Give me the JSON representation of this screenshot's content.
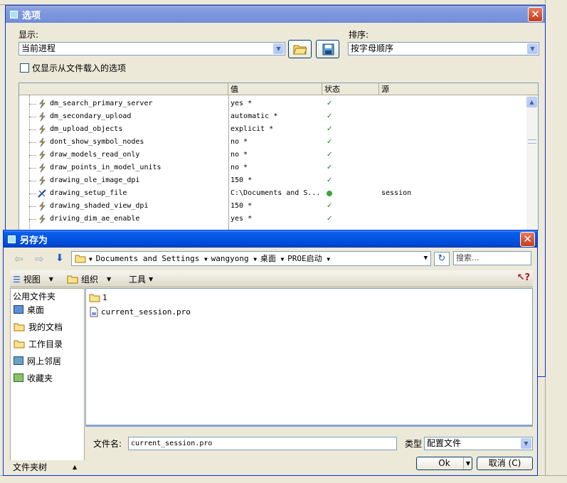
{
  "options_dialog": {
    "title": "选项",
    "display_label": "显示:",
    "display_value": "当前进程",
    "sort_label": "排序:",
    "sort_value": "按字母顺序",
    "only_file_checkbox": "仅显示从文件载入的选项",
    "columns": [
      "值",
      "状态",
      "源"
    ],
    "rows": [
      {
        "name": "dm_search_primary_server",
        "value": "yes *",
        "status": "check",
        "source": ""
      },
      {
        "name": "dm_secondary_upload",
        "value": "automatic *",
        "status": "check",
        "source": ""
      },
      {
        "name": "dm_upload_objects",
        "value": "explicit *",
        "status": "check",
        "source": ""
      },
      {
        "name": "dont_show_symbol_nodes",
        "value": "no *",
        "status": "check",
        "source": ""
      },
      {
        "name": "draw_models_read_only",
        "value": "no *",
        "status": "check",
        "source": ""
      },
      {
        "name": "draw_points_in_model_units",
        "value": "no *",
        "status": "check",
        "source": ""
      },
      {
        "name": "drawing_ole_image_dpi",
        "value": "150 *",
        "status": "check",
        "source": ""
      },
      {
        "name": "drawing_setup_file",
        "value": "C:\\Documents and S...",
        "status": "dot",
        "source": "session"
      },
      {
        "name": "drawing_shaded_view_dpi",
        "value": "150 *",
        "status": "check",
        "source": ""
      },
      {
        "name": "driving_dim_ae_enable",
        "value": "yes *",
        "status": "check",
        "source": ""
      }
    ]
  },
  "saveas_dialog": {
    "title": "另存为",
    "breadcrumb": [
      "Documents and Settings",
      "wangyong",
      "桌面",
      "PROE启动"
    ],
    "search_placeholder": "搜索...",
    "toolbar": {
      "view": "视图",
      "organize": "组织",
      "tools": "工具"
    },
    "places_header": "公用文件夹",
    "places": [
      "桌面",
      "我的文档",
      "工作目录",
      "网上邻居",
      "收藏夹"
    ],
    "files": [
      {
        "name": "1",
        "type": "folder"
      },
      {
        "name": "current_session.pro",
        "type": "file"
      }
    ],
    "filename_label": "文件名:",
    "filename_value": "current_session.pro",
    "type_label": "类型",
    "type_value": "配置文件",
    "ok_label": "Ok",
    "cancel_label": "取消 (C)",
    "folder_tree_label": "文件夹树"
  },
  "colors": {
    "titlebar": "#0054e3",
    "accent": "#316ac5",
    "check": "#0a8a0a",
    "dot": "#3aa83a"
  }
}
